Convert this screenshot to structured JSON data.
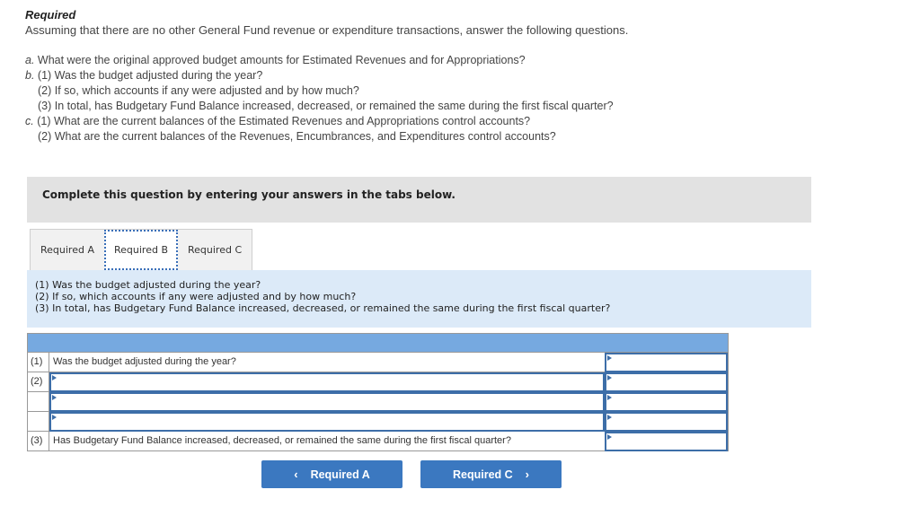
{
  "header": {
    "title": "Required",
    "intro": "Assuming that there are no other General Fund revenue or expenditure transactions, answer the following questions."
  },
  "questions": [
    {
      "prefix": "a.",
      "text": " What were the original approved budget amounts for Estimated Revenues and for Appropriations?",
      "indent": false
    },
    {
      "prefix": "b.",
      "text": " (1) Was the budget adjusted during the year?",
      "indent": false
    },
    {
      "prefix": "",
      "text": "(2) If so, which accounts if any were adjusted and by how much?",
      "indent": true
    },
    {
      "prefix": "",
      "text": "(3) In total, has Budgetary Fund Balance increased, decreased, or remained the same during the first fiscal quarter?",
      "indent": true
    },
    {
      "prefix": "c.",
      "text": " (1) What are the current balances of the Estimated Revenues and Appropriations control accounts?",
      "indent": false
    },
    {
      "prefix": "",
      "text": "(2) What are the current balances of the Revenues, Encumbrances, and Expenditures control accounts?",
      "indent": true
    }
  ],
  "banner": "Complete this question by entering your answers in the tabs below.",
  "tabs": [
    {
      "label": "Required A",
      "active": false
    },
    {
      "label": "Required B",
      "active": true
    },
    {
      "label": "Required C",
      "active": false
    }
  ],
  "prompt": {
    "line1": "(1) Was the budget adjusted during the year?",
    "line2": "(2) If so, which accounts if any were adjusted and by how much?",
    "line3": "(3) In total, has Budgetary Fund Balance increased, decreased, or remained the same during the first fiscal quarter?"
  },
  "grid": {
    "rows": [
      {
        "num": "(1)",
        "label": "Was the budget adjusted during the year?",
        "label_input": false,
        "label_value": "",
        "value": ""
      },
      {
        "num": "(2)",
        "label": "",
        "label_input": true,
        "label_value": "",
        "value": ""
      },
      {
        "num": "",
        "label": "",
        "label_input": true,
        "label_value": "",
        "value": ""
      },
      {
        "num": "",
        "label": "",
        "label_input": true,
        "label_value": "",
        "value": ""
      },
      {
        "num": "(3)",
        "label": "Has Budgetary Fund Balance increased, decreased, or remained the same during the first fiscal quarter?",
        "label_input": false,
        "label_value": "",
        "value": ""
      }
    ]
  },
  "nav": {
    "prev_label": "Required A",
    "next_label": "Required C",
    "prev_icon": "‹",
    "next_icon": "›"
  }
}
